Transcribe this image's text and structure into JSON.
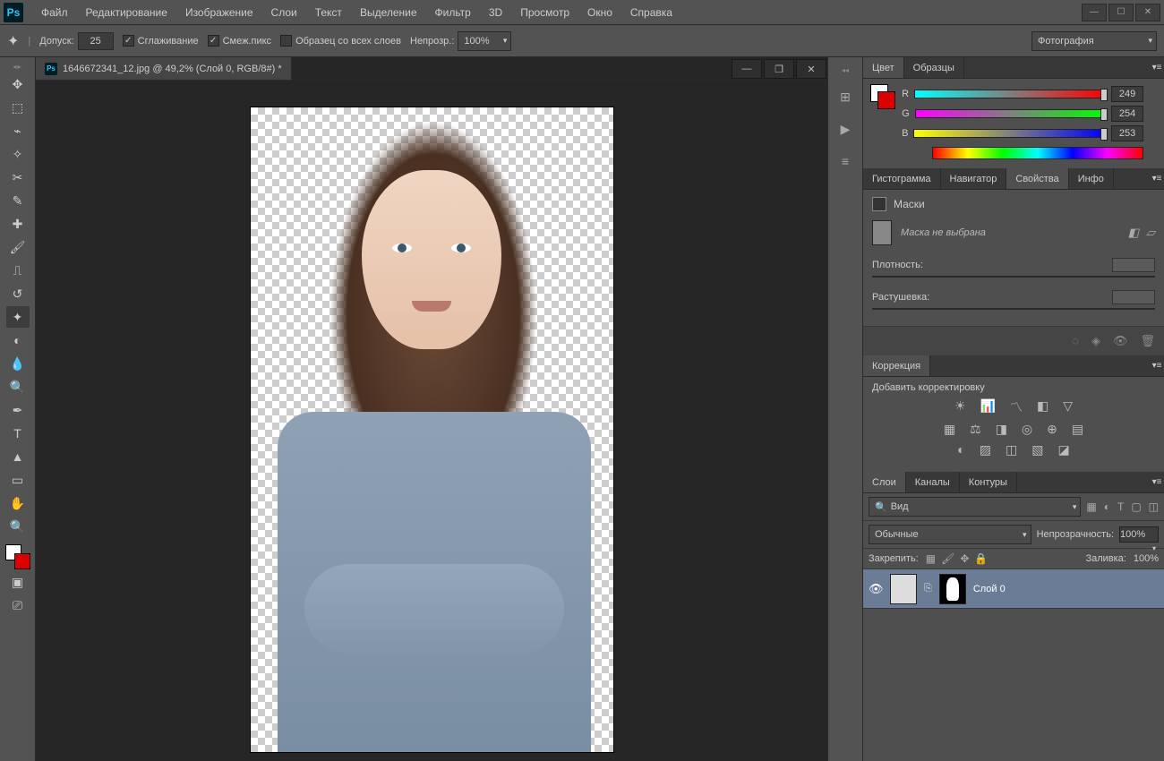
{
  "app": {
    "logo": "Ps"
  },
  "menu": {
    "file": "Файл",
    "edit": "Редактирование",
    "image": "Изображение",
    "layers": "Слои",
    "type": "Текст",
    "select": "Выделение",
    "filter": "Фильтр",
    "three_d": "3D",
    "view": "Просмотр",
    "window": "Окно",
    "help": "Справка"
  },
  "options": {
    "tolerance_label": "Допуск:",
    "tolerance_value": "25",
    "antialias": "Сглаживание",
    "contiguous": "Смеж.пикс",
    "sample_all": "Образец со всех слоев",
    "opacity_label": "Непрозр.:",
    "opacity_value": "100%",
    "workspace": "Фотография"
  },
  "document": {
    "title": "1646672341_12.jpg @ 49,2% (Слой 0, RGB/8#) *"
  },
  "panels": {
    "color": {
      "tab_color": "Цвет",
      "tab_swatches": "Образцы",
      "r_label": "R",
      "r_value": "249",
      "g_label": "G",
      "g_value": "254",
      "b_label": "B",
      "b_value": "253"
    },
    "nav": {
      "tab_histogram": "Гистограмма",
      "tab_navigator": "Навигатор",
      "tab_properties": "Свойства",
      "tab_info": "Инфо"
    },
    "properties": {
      "masks_label": "Маски",
      "no_mask": "Маска не выбрана",
      "density": "Плотность:",
      "feather": "Растушевка:"
    },
    "adjust": {
      "tab": "Коррекция",
      "add_label": "Добавить корректировку"
    },
    "layers": {
      "tab_layers": "Слои",
      "tab_channels": "Каналы",
      "tab_paths": "Контуры",
      "kind": "Вид",
      "blend": "Обычные",
      "opacity_label": "Непрозрачность:",
      "opacity_value": "100%",
      "lock_label": "Закрепить:",
      "fill_label": "Заливка:",
      "fill_value": "100%",
      "layer0": "Слой 0"
    }
  }
}
